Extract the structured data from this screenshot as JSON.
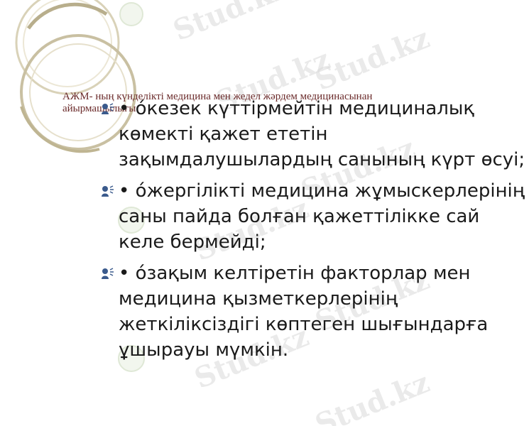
{
  "slide": {
    "title": "АЖМ- ның күнделікті медицина мен жедел жәрдем медицинасынан айырмашылығы:",
    "bullets": [
      "•   óкезек күттірмейтін медициналық көмекті қажет ететін зақымдалушылардың санының күрт өсуі;",
      "•   óжергілікті медицина жұмыскерлерінің саны пайда болған қажеттілікке сай келе бермейді;",
      "•   óзақым келтіретін факторлар мен медицина қызметкерлерінің жеткіліксіздігі көптеген шығындарға ұшырауы мүмкін."
    ],
    "bullet_icon": "speaker-person-icon",
    "watermark_text": "Stud.kz",
    "colors": {
      "title": "#6b2b2b",
      "text": "#1a1a1a",
      "icon": "#3a5a8c",
      "ring": "#c9c0a2",
      "watermark": "#d9d9d9"
    }
  }
}
